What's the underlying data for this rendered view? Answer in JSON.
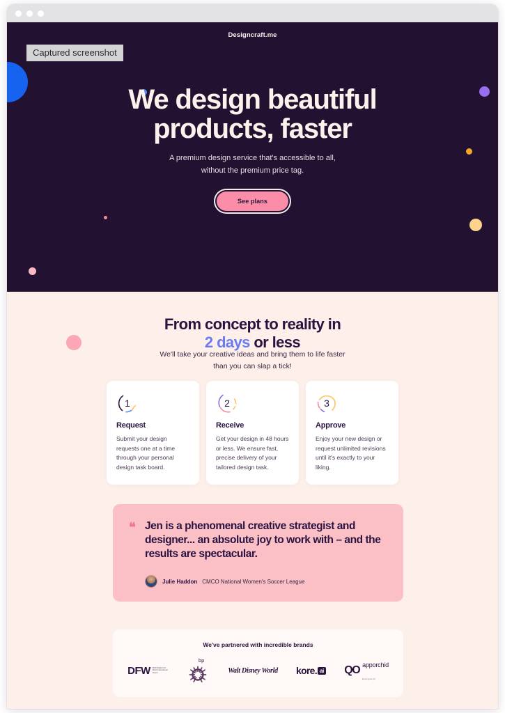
{
  "window": {
    "traffic_lights": [
      "close",
      "minimize",
      "maximize"
    ]
  },
  "overlay": {
    "capture_badge": "Captured screenshot"
  },
  "hero": {
    "site_title": "Designcraft.me",
    "heading_line1": "We design beautiful",
    "heading_line2": "products, faster",
    "subheading_line1": "A premium design service that's accessible to all,",
    "subheading_line2": "without the premium price tag.",
    "cta_label": "See plans",
    "background_color": "#231131",
    "cta_color": "#fb8da8",
    "decorations": [
      {
        "name": "blue-circle",
        "color": "#1663ef"
      },
      {
        "name": "blue-dot",
        "color": "#5b8bf7"
      },
      {
        "name": "pink-tiny-dot",
        "color": "#f58ba1"
      },
      {
        "name": "pink-small-dot",
        "color": "#fbb8c4"
      },
      {
        "name": "purple-dot",
        "color": "#9a6ef0"
      },
      {
        "name": "orange-dot",
        "color": "#f5a623"
      },
      {
        "name": "yellow-dot",
        "color": "#fcd38a"
      }
    ]
  },
  "process": {
    "heading_part1": "From concept to reality in",
    "heading_accent": "2 days",
    "heading_part2": " or less",
    "accent_color": "#6b7bf0",
    "subheading_line1": "We'll take your creative ideas and bring them to life faster",
    "subheading_line2": "than you can slap a tick!",
    "cards": [
      {
        "number": "1",
        "title": "Request",
        "body": "Submit your design requests one at a time through your personal design task board."
      },
      {
        "number": "2",
        "title": "Receive",
        "body": "Get your design in 48 hours or less. We ensure fast, precise delivery of your tailored design task."
      },
      {
        "number": "3",
        "title": "Approve",
        "body": "Enjoy your new design or request unlimited revisions until it's exactly to your liking."
      }
    ]
  },
  "testimonial": {
    "quote_mark": "❝",
    "quote": "Jen is a phenomenal creative strategist and designer... an absolute joy to work with – and the results are spectacular.",
    "author_name": "Julie Haddon",
    "author_role": "CMCO National Women's Soccer League",
    "background_color": "#fbc0c6"
  },
  "brands": {
    "title": "We've partnered with incredible brands",
    "logos": [
      {
        "name": "dfw",
        "label": "DFW",
        "sub": "DFW Dallas Fort Worth International Airport"
      },
      {
        "name": "bp",
        "label": "bp"
      },
      {
        "name": "walt-disney-world",
        "label": "Walt Disney World"
      },
      {
        "name": "kore-ai",
        "label": "kore.",
        "badge": "ai"
      },
      {
        "name": "apporchid",
        "mark": "QO",
        "label": "apporchid",
        "sub": "Enterprise AI"
      }
    ]
  }
}
